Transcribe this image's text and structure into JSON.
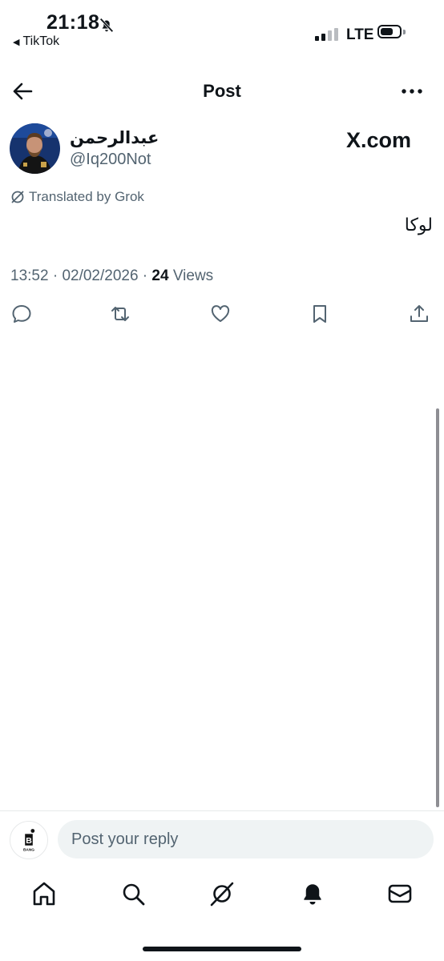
{
  "status_bar": {
    "time": "21:18",
    "back_app": "TikTok",
    "network": "LTE"
  },
  "header": {
    "title": "Post"
  },
  "post": {
    "author_name": "عبدالرحمن",
    "author_handle": "@Iq200Not",
    "source_logo": "X.com",
    "translated_label": "Translated by Grok",
    "text": "لوكا",
    "time": "13:52",
    "date": "02/02/2026",
    "views_count": "24",
    "views_label": "Views"
  },
  "actions": [
    "reply-icon",
    "repost-icon",
    "like-icon",
    "bookmark-icon",
    "share-icon"
  ],
  "reply_bar": {
    "avatar_text": "BANG",
    "placeholder": "Post your reply"
  },
  "tab_bar": [
    "home-icon",
    "search-icon",
    "grok-icon",
    "notifications-icon",
    "messages-icon"
  ],
  "colors": {
    "text": "#0f1419",
    "secondary": "#536471",
    "input_bg": "#eff3f4"
  }
}
